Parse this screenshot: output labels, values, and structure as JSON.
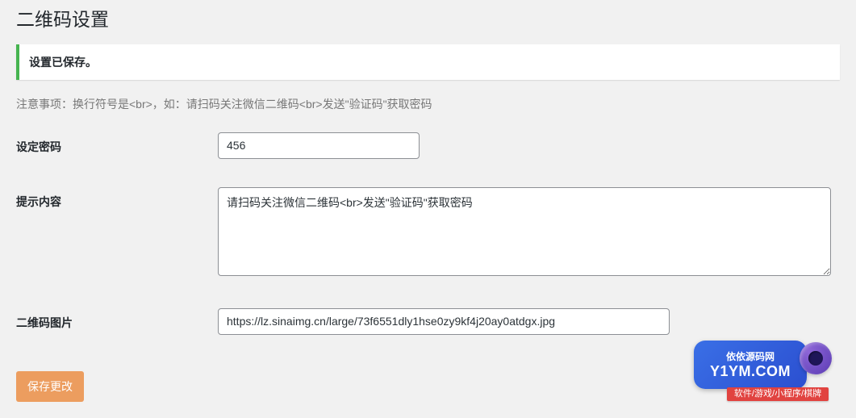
{
  "header": {
    "title": "二维码设置"
  },
  "notice": {
    "message": "设置已保存。"
  },
  "help": {
    "text": "注意事项：换行符号是<br>，如：请扫码关注微信二维码<br>发送\"验证码\"获取密码"
  },
  "form": {
    "password": {
      "label": "设定密码",
      "value": "456"
    },
    "hint": {
      "label": "提示内容",
      "value": "请扫码关注微信二维码<br>发送\"验证码\"获取密码"
    },
    "qrimage": {
      "label": "二维码图片",
      "value": "https://lz.sinaimg.cn/large/73f6551dly1hse0zy9kf4j20ay0atdgx.jpg"
    },
    "submit": {
      "label": "保存更改"
    }
  },
  "watermark": {
    "line1": "依依源码网",
    "line2": "Y1YM.COM",
    "bar": "软件/游戏/小程序/棋牌"
  }
}
